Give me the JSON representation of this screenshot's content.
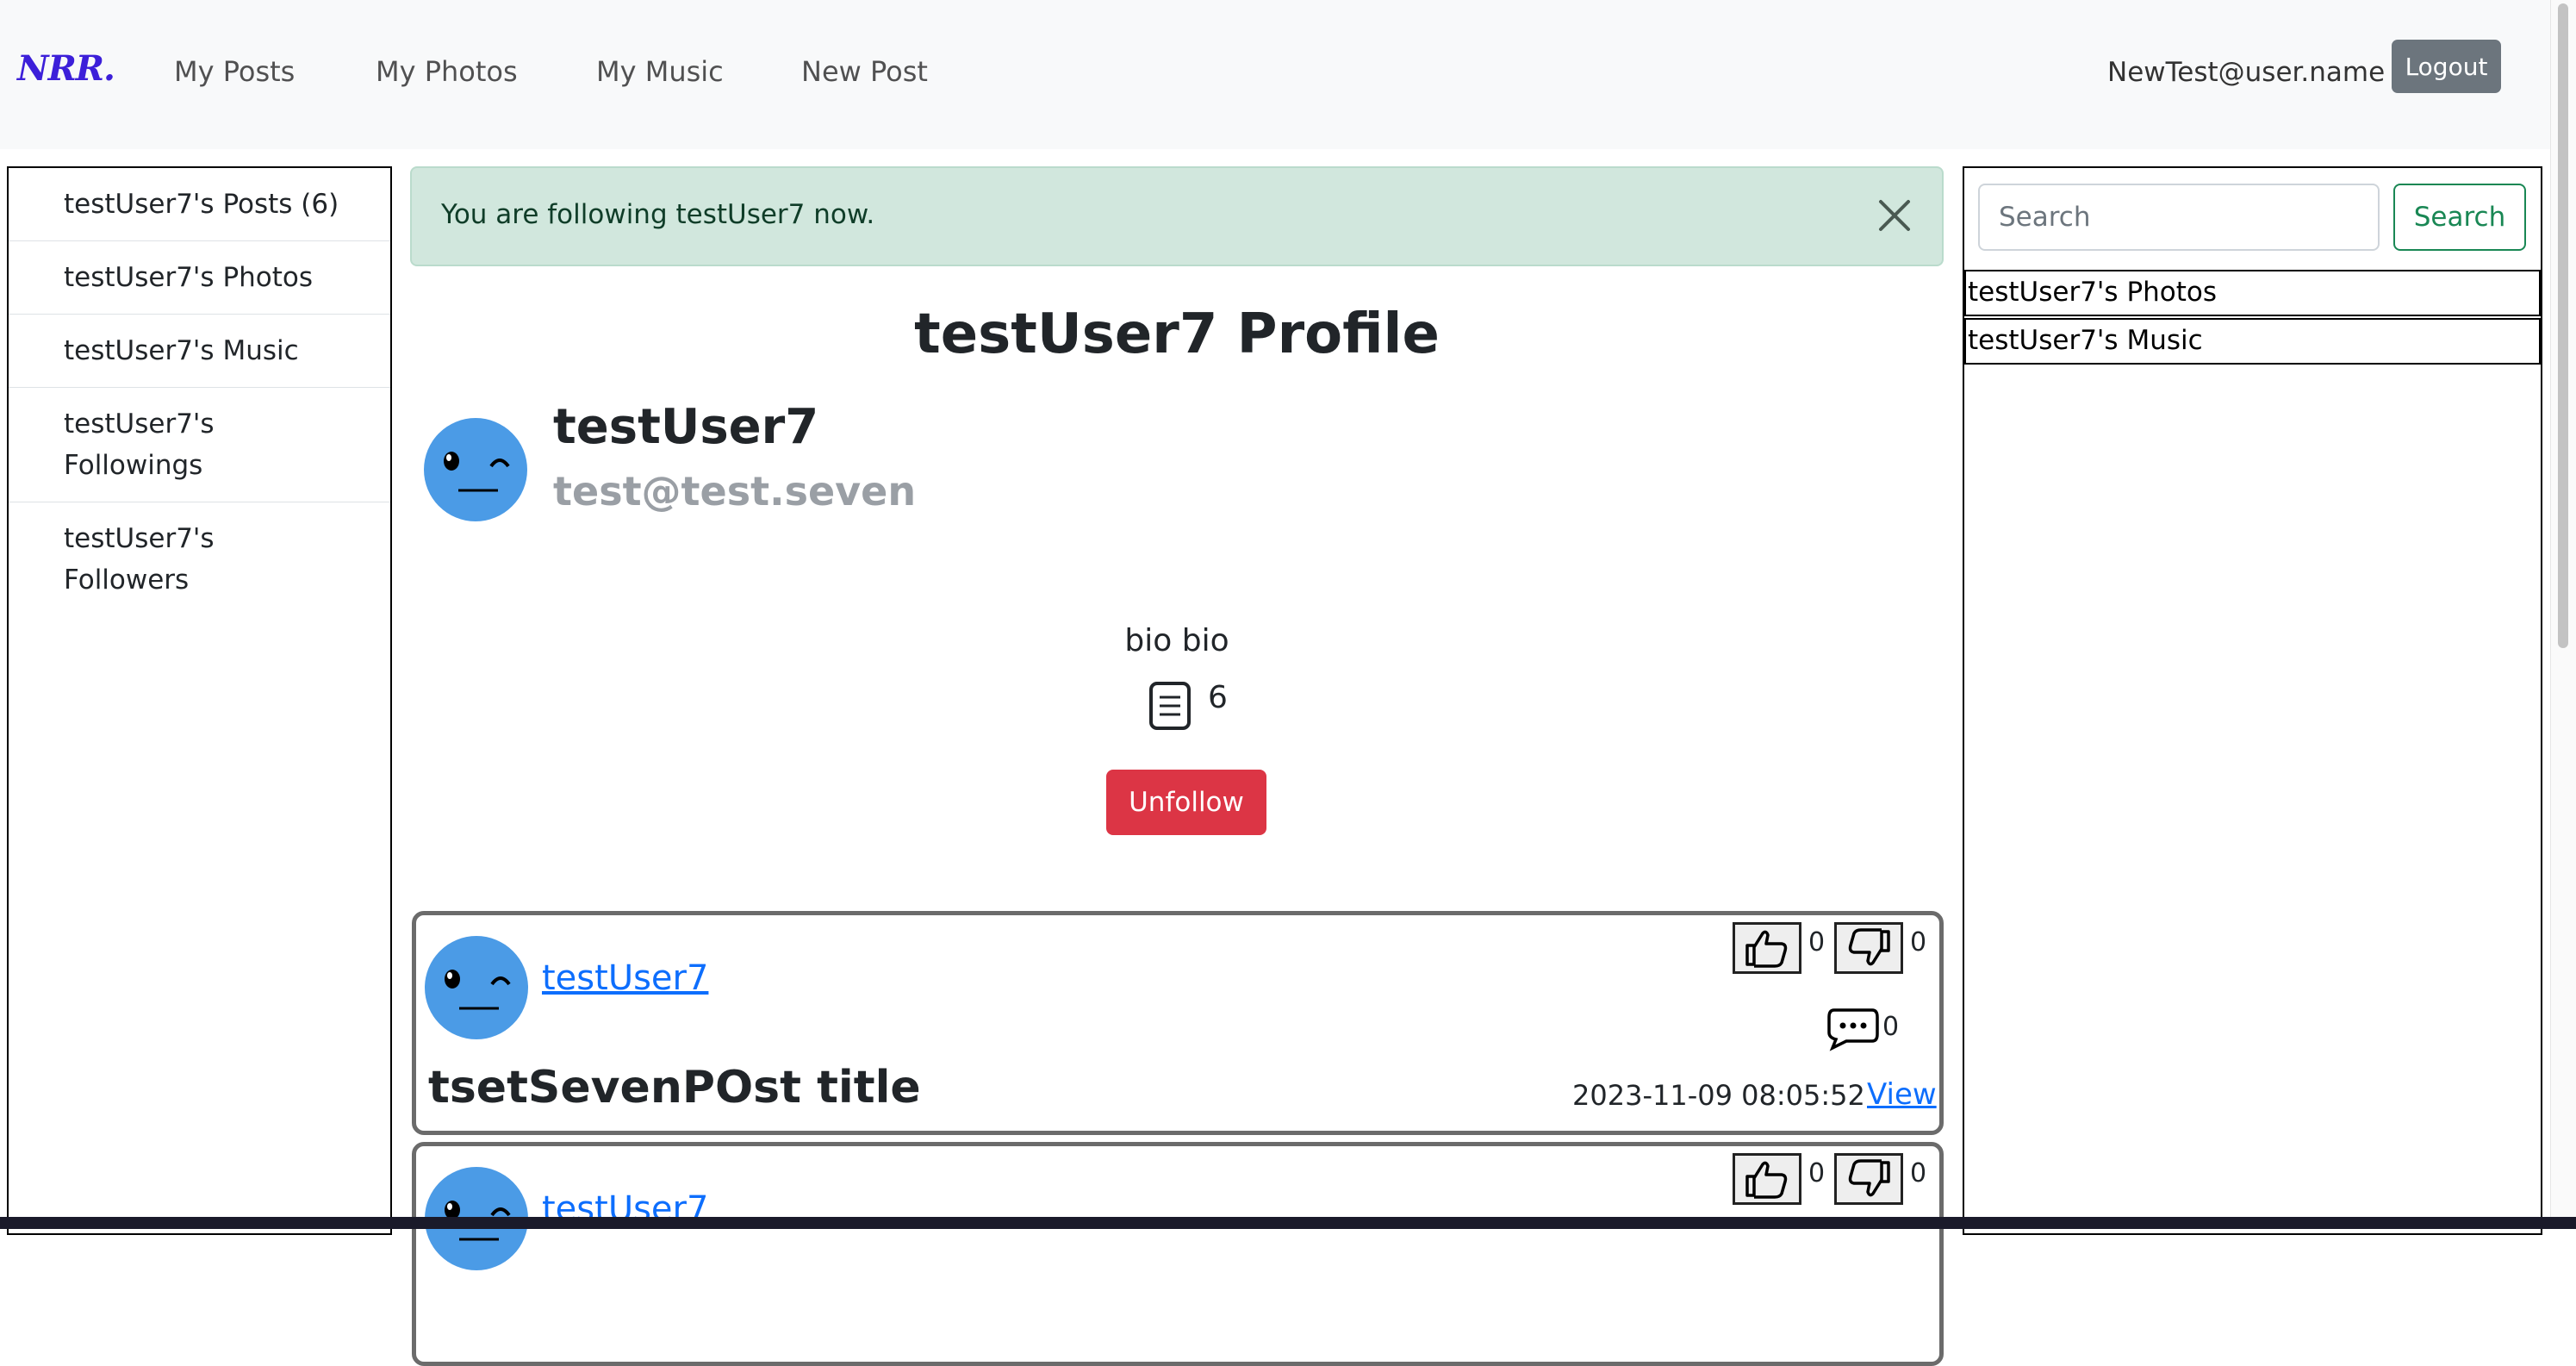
{
  "navbar": {
    "brand": "NRR.",
    "links": [
      "My Posts",
      "My Photos",
      "My Music",
      "New Post"
    ],
    "user": "NewTest@user.name",
    "logout_label": "Logout"
  },
  "left_sidebar": {
    "items": [
      "testUser7's Posts (6)",
      "testUser7's Photos",
      "testUser7's Music",
      "testUser7's Followings",
      "testUser7's Followers"
    ]
  },
  "alert": {
    "text": "You are following testUser7 now."
  },
  "profile": {
    "title": "testUser7 Profile",
    "username": "testUser7",
    "email": "test@test.seven",
    "bio": "bio bio",
    "post_count": "6",
    "unfollow_label": "Unfollow"
  },
  "posts": [
    {
      "author": "testUser7",
      "title": "tsetSevenPOst title",
      "likes": "0",
      "dislikes": "0",
      "comments": "0",
      "date": "2023-11-09 08:05:52",
      "view_label": "View"
    },
    {
      "author": "testUser7",
      "likes": "0",
      "dislikes": "0"
    }
  ],
  "right_sidebar": {
    "search_placeholder": "Search",
    "search_label": "Search",
    "links": [
      "testUser7's Photos",
      "testUser7's Music"
    ]
  },
  "colors": {
    "brand": "#3c1fd9",
    "alert_bg": "#d1e7dd",
    "unfollow": "#dc3545",
    "search": "#198754",
    "link": "#0d6efd",
    "avatar": "#4b9be6"
  },
  "icons": {
    "post_count": "document-lines-icon",
    "like": "thumbs-up-icon",
    "dislike": "thumbs-down-icon",
    "comment": "comment-bubble-icon",
    "close": "close-icon",
    "avatar": "wink-face-icon"
  }
}
